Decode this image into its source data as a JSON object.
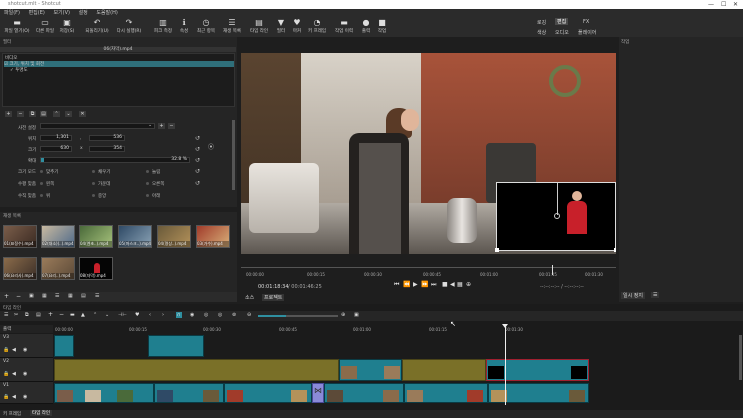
{
  "window": {
    "title": "shotcut.mlt - Shotcut"
  },
  "menu": [
    "파일(F)",
    "편집(E)",
    "보기(V)",
    "설정",
    "도움말(H)"
  ],
  "toolbar": {
    "items": [
      {
        "icon": "folder-icon",
        "label": "파일 열기(O)"
      },
      {
        "icon": "folder-icon",
        "label": "다른 파일"
      },
      {
        "icon": "save-icon",
        "label": "저장(S)"
      },
      {
        "icon": "undo-icon",
        "label": "되돌리기(U)"
      },
      {
        "icon": "redo-icon",
        "label": "다시 실행(R)"
      },
      {
        "icon": "peak-meter-icon",
        "label": "피크 측정"
      },
      {
        "icon": "info-icon",
        "label": "속성"
      },
      {
        "icon": "recent-icon",
        "label": "최근 항목"
      },
      {
        "icon": "playlist-icon",
        "label": "재생 목록"
      },
      {
        "icon": "timeline-icon",
        "label": "타임 라인"
      },
      {
        "icon": "filter-icon",
        "label": "필터"
      },
      {
        "icon": "marker-icon",
        "label": "마커"
      },
      {
        "icon": "keyframe-icon",
        "label": "키 프레임"
      },
      {
        "icon": "history-icon",
        "label": "작업 이력"
      },
      {
        "icon": "export-icon",
        "label": "출력"
      },
      {
        "icon": "jobs-icon",
        "label": "작업"
      }
    ],
    "layouts": {
      "logging": "로깅",
      "editing": "편집",
      "fx": "FX",
      "color": "색상",
      "audio": "오디오",
      "player": "플레이어"
    }
  },
  "filters": {
    "panel_title": "필터",
    "clip_name": "06(자막).mp4",
    "section": "비디오",
    "items": [
      "크기, 위치 및 회전",
      "투명도"
    ],
    "preset_label": "사전 설정",
    "position_label": "위치",
    "pos_x": "1,301",
    "pos_y": "536",
    "size_label": "크기",
    "size_w": "630",
    "size_h": "354",
    "zoom_label": "확대",
    "zoom_value": "32.8 %",
    "size_mode_label": "크기 모드",
    "size_modes": [
      "맞추기",
      "채우기",
      "늘림"
    ],
    "h_align_label": "수평 맞춤",
    "h_aligns": [
      "왼쪽",
      "가운데",
      "오른쪽"
    ],
    "v_align_label": "수직 맞춤",
    "v_aligns": [
      "위",
      "중앙",
      "아래"
    ]
  },
  "playlist": {
    "panel_title": "재생 목록",
    "items": [
      "01(표정수).mp4",
      "02(대소)(..).mp4",
      "04(엔초..).mp4",
      "05(마스크..).mp4",
      "04(명상..).mp4",
      "03(가수).mp4",
      "06(요리사).mp4",
      "07(요리..).mp4",
      "08(자막).mp4"
    ]
  },
  "viewer": {
    "ruler": [
      "00:00:00",
      "00:00:15",
      "00:00:30",
      "00:00:45",
      "00:01:00",
      "00:01:15",
      "00:01:30"
    ],
    "current_time": "00:01:18:34",
    "duration": "00:01:46:25",
    "in_out": "--:--:--:-- / --:--:--:--",
    "tabs": [
      "소스",
      "프로젝트"
    ]
  },
  "jobs": {
    "panel_title": "작업",
    "pause_label": "일시 정지"
  },
  "timeline": {
    "panel_title": "타임 라인",
    "output_label": "출력",
    "ruler": [
      "00:00:00",
      "00:00:15",
      "00:00:30",
      "00:00:45",
      "00:01:00",
      "00:01:15",
      "00:01:30"
    ],
    "tracks": [
      "V3",
      "V2",
      "V1"
    ],
    "bottom_tabs": [
      "키 프레임",
      "타임 라인"
    ]
  },
  "colors": {
    "accent": "#2f8fa0",
    "clip_blue": "#1f7f8f",
    "clip_olive": "#7a7028"
  }
}
